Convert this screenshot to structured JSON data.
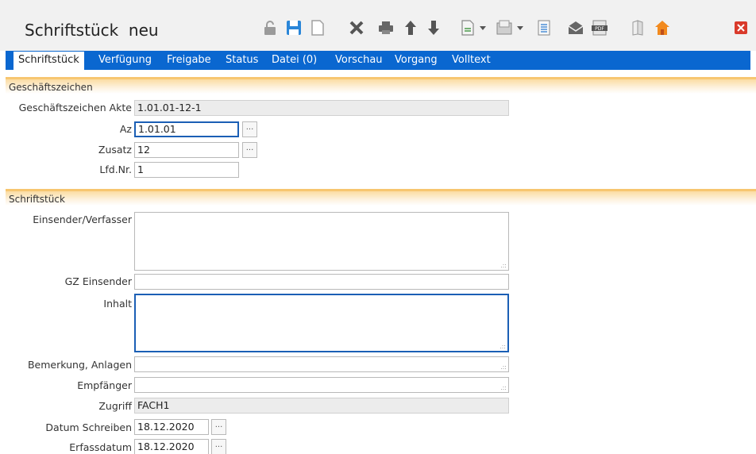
{
  "header": {
    "title": "Schriftstück  neu"
  },
  "toolbar": {
    "icons": [
      "lock-icon",
      "save-icon",
      "new-document-icon",
      "delete-icon",
      "print-icon",
      "arrow-up-icon",
      "arrow-down-icon",
      "document-dropdown-icon",
      "scan-dropdown-icon",
      "list-document-icon",
      "mail-icon",
      "pdf-icon",
      "book-icon",
      "home-icon",
      "close-icon"
    ],
    "pdf_label": "PDF"
  },
  "tabs": [
    {
      "label": "Schriftstück",
      "active": true
    },
    {
      "label": "Verfügung"
    },
    {
      "label": "Freigabe"
    },
    {
      "label": "Status"
    },
    {
      "label": "Datei (0)"
    },
    {
      "label": "Vorschau"
    },
    {
      "label": "Vorgang"
    },
    {
      "label": "Volltext"
    }
  ],
  "sections": {
    "gz": "Geschäftszeichen",
    "doc": "Schriftstück"
  },
  "fields": {
    "gz_akte": {
      "label": "Geschäftszeichen Akte",
      "value": "1.01.01-12-1"
    },
    "az": {
      "label": "Az",
      "value": "1.01.01"
    },
    "zusatz": {
      "label": "Zusatz",
      "value": "12"
    },
    "lfdnr": {
      "label": "Lfd.Nr.",
      "value": "1"
    },
    "einsender": {
      "label": "Einsender/Verfasser",
      "value": ""
    },
    "gz_einsender": {
      "label": "GZ Einsender",
      "value": ""
    },
    "inhalt": {
      "label": "Inhalt",
      "value": ""
    },
    "bemerkung": {
      "label": "Bemerkung, Anlagen",
      "value": ""
    },
    "empfaenger": {
      "label": "Empfänger",
      "value": ""
    },
    "zugriff": {
      "label": "Zugriff",
      "value": "FACH1"
    },
    "datum_schreiben": {
      "label": "Datum Schreiben",
      "value": "18.12.2020"
    },
    "erfassdatum": {
      "label": "Erfassdatum",
      "value": "18.12.2020"
    }
  },
  "picker_label": "...",
  "grip_glyph": ".::"
}
